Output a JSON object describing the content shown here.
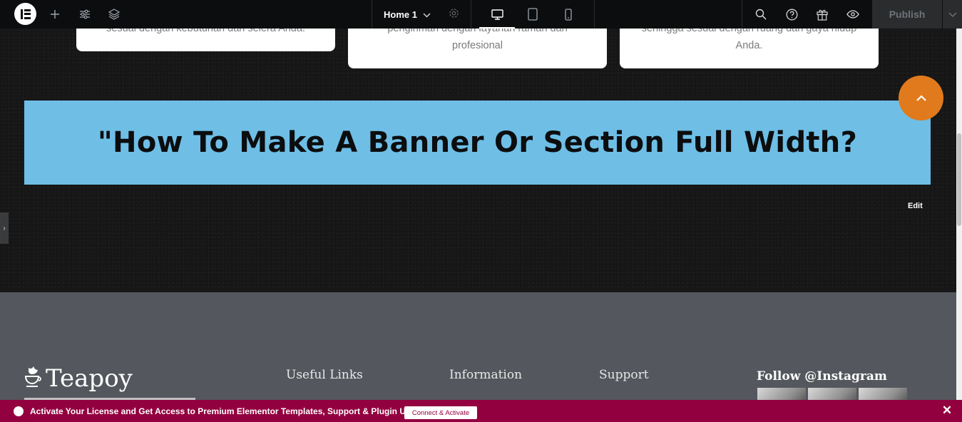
{
  "topbar": {
    "page_name": "Home 1",
    "publish_label": "Publish",
    "icons": [
      "elementor-logo-icon",
      "add-element-icon",
      "site-settings-icon",
      "structure-layers-icon",
      "page-settings-gear-icon",
      "desktop-icon",
      "tablet-icon",
      "mobile-icon",
      "search-icon",
      "help-icon",
      "whats-new-gift-icon",
      "preview-eye-icon",
      "chevron-down-icon"
    ]
  },
  "cards": [
    {
      "text": "sesuai dengan kebutuhan dan selera Anda."
    },
    {
      "line1": "pengiriman dengan layanan ramah dan",
      "line2": "profesional"
    },
    {
      "line1": "sehingga sesuai dengan ruang dan gaya hidup",
      "line2": "Anda."
    }
  ],
  "banner": {
    "heading": "\"How To Make A Banner Or Section Full Width?",
    "bg_color": "#6ebee6"
  },
  "edit_label": "Edit",
  "footer": {
    "brand": "Teapoy",
    "columns": [
      "Useful Links",
      "Information",
      "Support"
    ],
    "instagram_heading": "Follow @Instagram",
    "to_top_arrow": "^"
  },
  "notice": {
    "text": "Activate Your License and Get Access to Premium Elementor Templates, Support & Plugin Updates.",
    "button_label": "Connect & Activate",
    "close": "✕",
    "color": "#93003f"
  }
}
